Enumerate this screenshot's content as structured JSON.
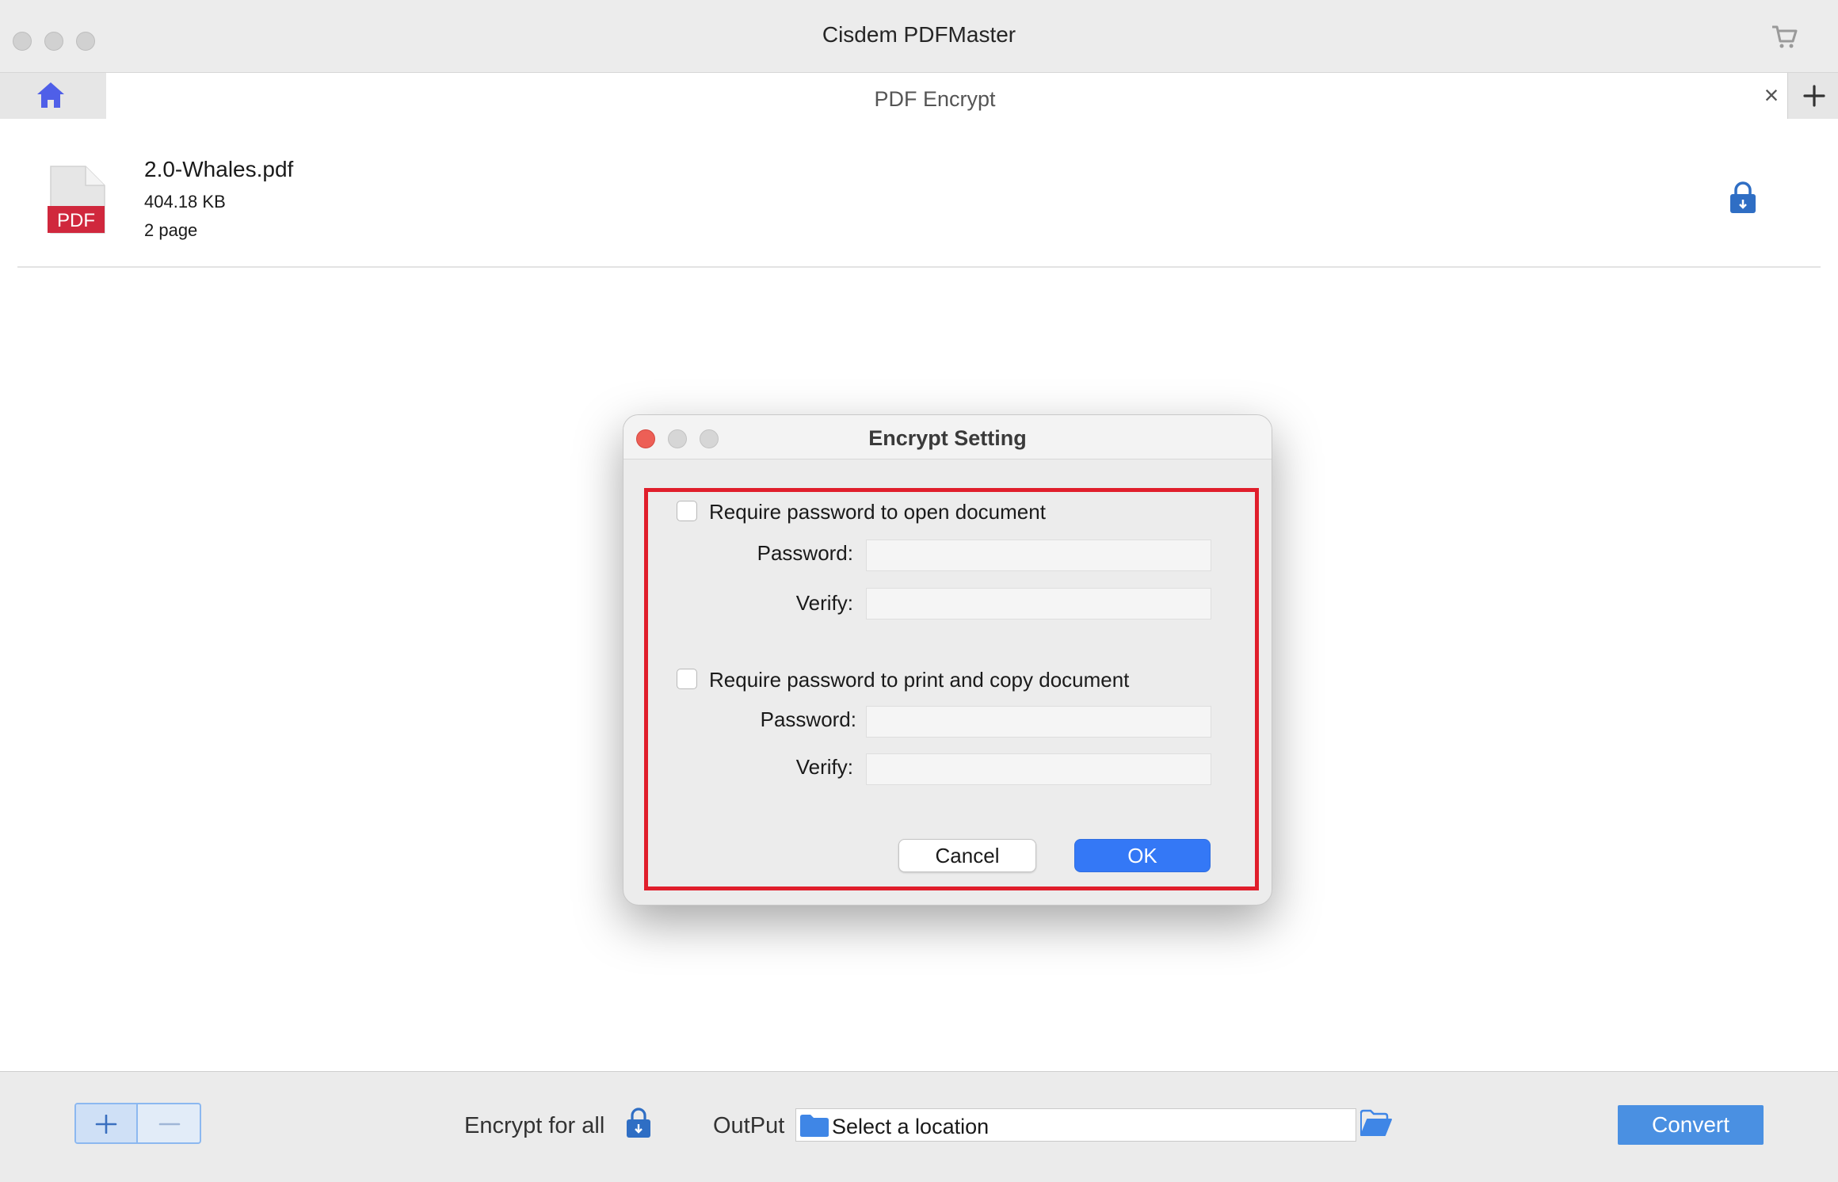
{
  "window": {
    "title": "Cisdem PDFMaster"
  },
  "tabs": {
    "active_title": "PDF Encrypt",
    "close_glyph": "×"
  },
  "file": {
    "name": "2.0-Whales.pdf",
    "icon_label": "PDF",
    "size": "404.18 KB",
    "pages": "2 page"
  },
  "dialog": {
    "title": "Encrypt Setting",
    "open_section": {
      "checkbox_label": "Require password to open document",
      "checked": false,
      "password_label": "Password:",
      "password_value": "",
      "verify_label": "Verify:",
      "verify_value": ""
    },
    "print_section": {
      "checkbox_label": "Require password to print and copy document",
      "checked": false,
      "password_label": "Password:",
      "password_value": "",
      "verify_label": "Verify:",
      "verify_value": ""
    },
    "cancel_label": "Cancel",
    "ok_label": "OK",
    "highlight_color": "#e01e2b"
  },
  "bottom": {
    "encrypt_all_label": "Encrypt for all",
    "output_label": "OutPut",
    "output_placeholder": "Select a location",
    "convert_label": "Convert"
  },
  "colors": {
    "accent": "#3478f6",
    "convert": "#4a90e2",
    "pdf_red": "#d0283d",
    "home_icon": "#4f5fe8",
    "lock_blue": "#2f6ec4"
  },
  "icons": [
    "cart-icon",
    "home-icon",
    "close-icon",
    "plus-icon",
    "pdf-file-icon",
    "lock-icon",
    "minus-icon",
    "folder-icon",
    "open-folder-icon"
  ]
}
